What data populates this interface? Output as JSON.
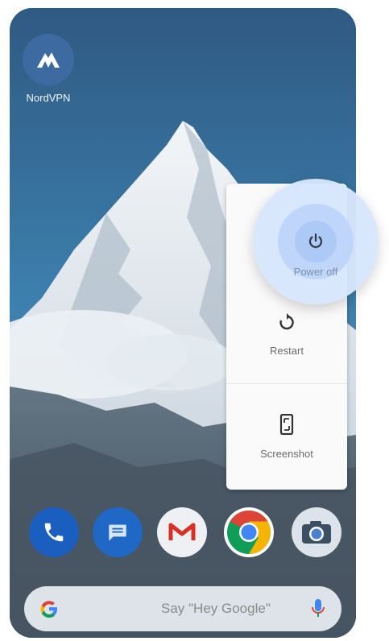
{
  "home": {
    "app_label": "NordVPN"
  },
  "power_menu": {
    "power_off_label": "Power off",
    "restart_label": "Restart",
    "screenshot_label": "Screenshot"
  },
  "dock": {
    "icons": [
      "phone-icon",
      "messages-icon",
      "gmail-icon",
      "chrome-icon",
      "camera-icon"
    ]
  },
  "search_bar": {
    "placeholder": "Say \"Hey Google\"",
    "left_icon": "google-g-icon",
    "right_icon": "microphone-icon"
  },
  "colors": {
    "accent": "#7fb0f0",
    "menu_bg": "#fafafa",
    "phone_blue": "#1a5fbf",
    "gmail_red": "#d93025",
    "chrome_red": "#db4437",
    "chrome_yellow": "#f4b400",
    "chrome_green": "#0f9d58",
    "chrome_blue": "#4285f4"
  }
}
